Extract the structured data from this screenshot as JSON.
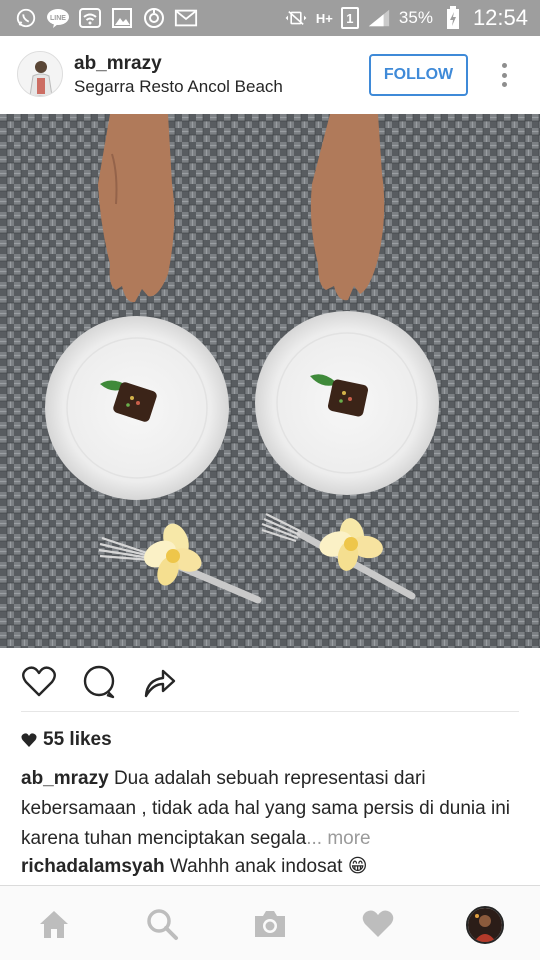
{
  "status_bar": {
    "battery_percent": "35%",
    "time": "12:54",
    "network_label": "H+",
    "sim_label": "1",
    "left_icons": [
      "whatsapp-icon",
      "line-icon",
      "wifi-icon",
      "gallery-icon",
      "sync-icon",
      "gmail-icon"
    ]
  },
  "post": {
    "username": "ab_mrazy",
    "location": "Segarra Resto Ancol Beach",
    "follow_label": "FOLLOW",
    "likes": "55 likes",
    "caption": {
      "user": "ab_mrazy",
      "text": "Dua adalah sebuah representasi dari kebersamaan , tidak ada hal yang sama persis di dunia ini karena tuhan menciptakan segala",
      "more": "... more"
    },
    "comment": {
      "user": "richadalamsyah",
      "text": "Wahhh anak indosat",
      "emoji": "😁"
    }
  },
  "colors": {
    "accent": "#3f8ad8",
    "status_bar": "#9e9e9e",
    "nav_inactive": "#bdbdbd"
  },
  "bottom_nav": [
    "home-icon",
    "search-icon",
    "camera-icon",
    "activity-heart-icon",
    "profile-avatar"
  ]
}
